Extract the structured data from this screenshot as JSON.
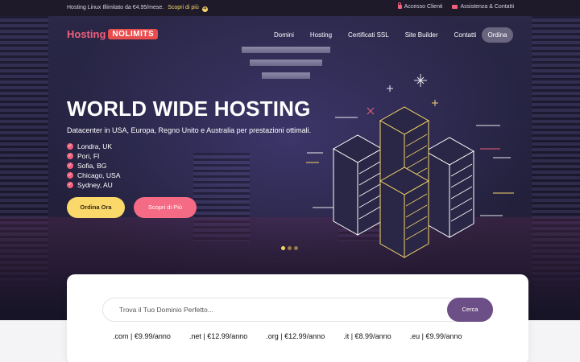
{
  "topbar": {
    "promo_text": "Hosting Linux Illimitato da €4.95/mese.",
    "promo_link": "Scopri di più",
    "client_area": "Accesso Clienti",
    "support": "Assistenza & Contatti",
    "icons": [
      "lock-icon",
      "mail-icon",
      "arrow-circle-icon"
    ]
  },
  "brand": {
    "word1": "Hosting",
    "word2": "NOLIMITS"
  },
  "nav": {
    "items": [
      "Domini",
      "Hosting",
      "Certificati SSL",
      "Site Builder",
      "Contatti"
    ],
    "order": "Ordina"
  },
  "hero": {
    "title": "WORLD WIDE HOSTING",
    "subtitle": "Datacenter in USA, Europa, Regno Unito e Australia per prestazioni ottimali.",
    "locations": [
      "Londra, UK",
      "Pori, FI",
      "Sofia, BG",
      "Chicago, USA",
      "Sydney, AU"
    ],
    "btn_order": "Ordina Ora",
    "btn_more": "Scopri di Più",
    "slides": 3,
    "active_slide": 1
  },
  "colors": {
    "accent_pink": "#f56a84",
    "accent_yellow": "#fad86a",
    "search_btn": "#6c4f86"
  },
  "search": {
    "placeholder": "Trova il Tuo Dominio Perfetto...",
    "button": "Cerca",
    "tlds": [
      ".com | €9.99/anno",
      ".net | €12.99/anno",
      ".org | €12.99/anno",
      ".it | €8.99/anno",
      ".eu | €9.99/anno"
    ]
  }
}
